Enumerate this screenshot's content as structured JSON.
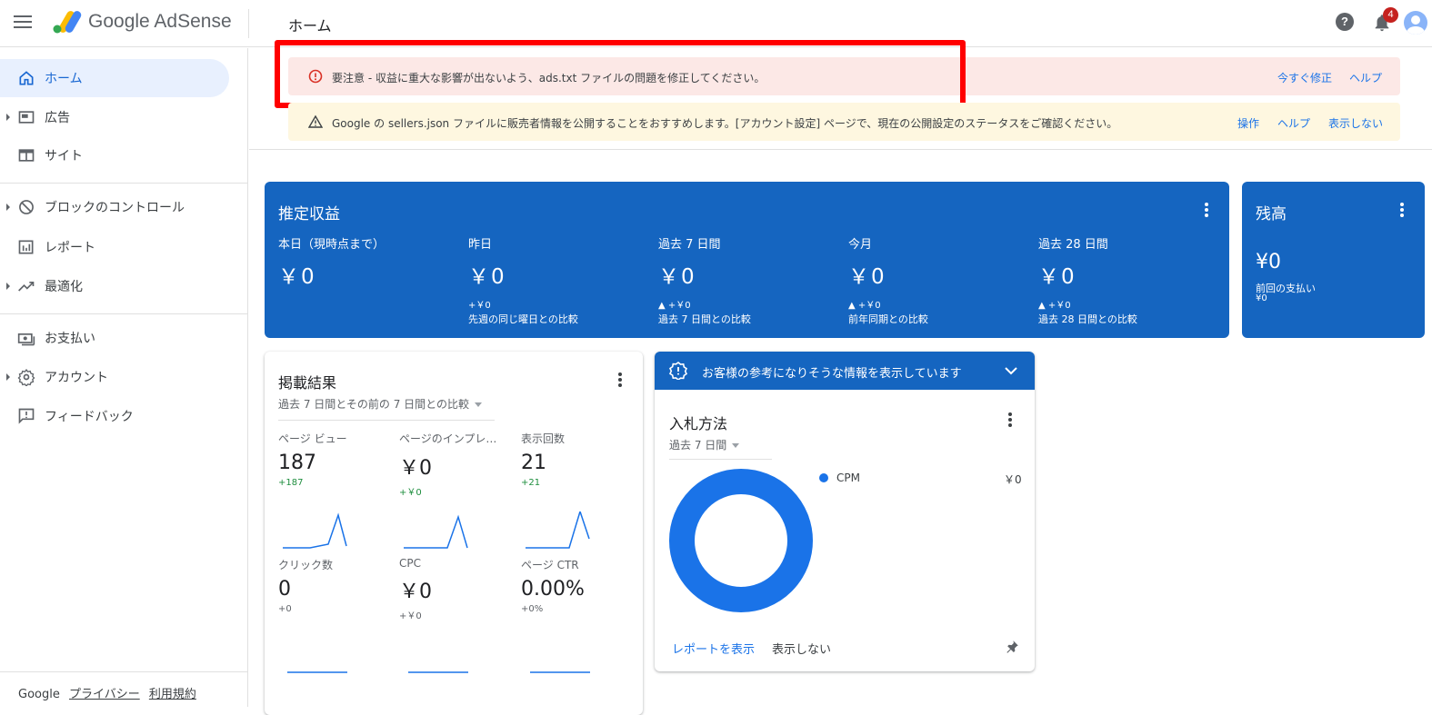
{
  "app": {
    "brand": "Google AdSense",
    "page_title": "ホーム",
    "notification_count": "4",
    "help_glyph": "?"
  },
  "sidebar": {
    "items": [
      {
        "label": "ホーム",
        "icon": "home-icon",
        "active": true
      },
      {
        "label": "広告",
        "icon": "ads-icon"
      },
      {
        "label": "サイト",
        "icon": "sites-icon"
      },
      {
        "label": "ブロックのコントロール",
        "icon": "block-icon"
      },
      {
        "label": "レポート",
        "icon": "reports-icon"
      },
      {
        "label": "最適化",
        "icon": "optimization-icon"
      },
      {
        "label": "お支払い",
        "icon": "payments-icon"
      },
      {
        "label": "アカウント",
        "icon": "gear-icon"
      },
      {
        "label": "フィードバック",
        "icon": "feedback-icon"
      }
    ],
    "footer": {
      "google": "Google",
      "privacy": "プライバシー",
      "terms": "利用規約"
    }
  },
  "alerts": {
    "red": {
      "text": "要注意 - 収益に重大な影響が出ないよう、ads.txt ファイルの問題を修正してください。",
      "fix": "今すぐ修正",
      "help": "ヘルプ"
    },
    "yellow": {
      "text": "Google の sellers.json ファイルに販売者情報を公開することをおすすめします。[アカウント設定] ページで、現在の公開設定のステータスをご確認ください。",
      "action": "操作",
      "help": "ヘルプ",
      "dismiss": "表示しない"
    }
  },
  "earnings": {
    "title": "推定収益",
    "columns": [
      {
        "label": "本日（現時点まで）",
        "value": "￥0",
        "delta": "",
        "compare": ""
      },
      {
        "label": "昨日",
        "value": "￥0",
        "delta": "+￥0",
        "compare": "先週の同じ曜日との比較"
      },
      {
        "label": "過去 7 日間",
        "value": "￥0",
        "delta": "▲ +￥0",
        "compare": "過去 7 日間との比較"
      },
      {
        "label": "今月",
        "value": "￥0",
        "delta": "▲ +￥0",
        "compare": "前年同期との比較"
      },
      {
        "label": "過去 28 日間",
        "value": "￥0",
        "delta": "▲ +￥0",
        "compare": "過去 28 日間との比較"
      }
    ]
  },
  "balance": {
    "title": "残高",
    "value": "¥0",
    "last_payment_label": "前回の支払い",
    "last_payment_value": "¥0"
  },
  "performance": {
    "title": "掲載結果",
    "subtitle": "過去 7 日間とその前の 7 日間との比較",
    "metrics": [
      {
        "label": "ページ ビュー",
        "value": "187",
        "delta": "+187"
      },
      {
        "label": "ページのインプレ…",
        "value": "￥0",
        "delta": "+￥0"
      },
      {
        "label": "表示回数",
        "value": "21",
        "delta": "+21"
      },
      {
        "label": "クリック数",
        "value": "0",
        "delta": "+0"
      },
      {
        "label": "CPC",
        "value": "￥0",
        "delta": "+￥0"
      },
      {
        "label": "ページ CTR",
        "value": "0.00%",
        "delta": "+0%"
      }
    ]
  },
  "info": {
    "header": "お客様の参考になりそうな情報を表示しています",
    "title": "入札方法",
    "subtitle": "過去 7 日間",
    "legend": [
      {
        "label": "CPM",
        "value": "￥0",
        "share": 1.0,
        "color": "#1a73e8"
      }
    ],
    "report_link": "レポートを表示",
    "dismiss": "表示しない"
  },
  "colors": {
    "accent": "#1a73e8",
    "card_blue": "#1565c0",
    "alert_red_bg": "#fce8e6",
    "alert_yellow_bg": "#fef7e0",
    "highlight": "#ff0000",
    "positive": "#1e8e3e"
  }
}
